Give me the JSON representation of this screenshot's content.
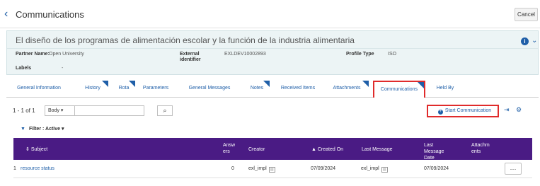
{
  "header": {
    "title": "Communications",
    "cancel_label": "Cancel"
  },
  "record": {
    "title": "El diseño de los programas de alimentación escolar y la función de la industria alimentaria",
    "partner_label": "Partner Name:",
    "partner_value": "Open University",
    "external_label": "External identifier",
    "external_value": "EXLDEV10002893",
    "profile_label": "Profile Type",
    "profile_value": "ISO",
    "labels_label": "Labels",
    "labels_value": "-"
  },
  "tabs": [
    {
      "label": "General Information",
      "flag": false,
      "active": false
    },
    {
      "label": "History",
      "flag": true,
      "active": false
    },
    {
      "label": "Rota",
      "flag": true,
      "active": false
    },
    {
      "label": "Parameters",
      "flag": false,
      "active": false
    },
    {
      "label": "General Messages",
      "flag": false,
      "active": false
    },
    {
      "label": "Notes",
      "flag": true,
      "active": false
    },
    {
      "label": "Received Items",
      "flag": false,
      "active": false
    },
    {
      "label": "Attachments",
      "flag": true,
      "active": false
    },
    {
      "label": "Communications",
      "flag": true,
      "active": true
    },
    {
      "label": "Held By",
      "flag": false,
      "active": false
    }
  ],
  "toolbar": {
    "count": "1 - 1 of 1",
    "search_scope": "Body",
    "search_value": "",
    "start_label": "Start Communication"
  },
  "filter": {
    "label": "Filter : Active"
  },
  "table": {
    "headers": {
      "subject": "Subject",
      "answers": "Answers",
      "creator": "Creator",
      "created_on": "Created On",
      "last_message": "Last Message",
      "last_message_date": "Last Message Date",
      "attachments": "Attachments"
    },
    "rows": [
      {
        "index": "1",
        "subject": "resource status",
        "answers": "0",
        "creator": "exl_impl",
        "created_on": "07/09/2024",
        "last_message": "exl_impl",
        "last_message_date": "07/09/2024",
        "attachments": ""
      }
    ]
  },
  "colors": {
    "accent": "#1f5fa8",
    "header_bg": "#4a1b84",
    "highlight": "#e02b2b",
    "panel_bg": "#ecf4f5"
  },
  "icons": [
    "back-chevron-icon",
    "info-icon",
    "chevron-down-icon",
    "search-icon",
    "plus-circle-icon",
    "export-icon",
    "gear-icon",
    "filter-icon",
    "user-icon",
    "more-icon"
  ]
}
